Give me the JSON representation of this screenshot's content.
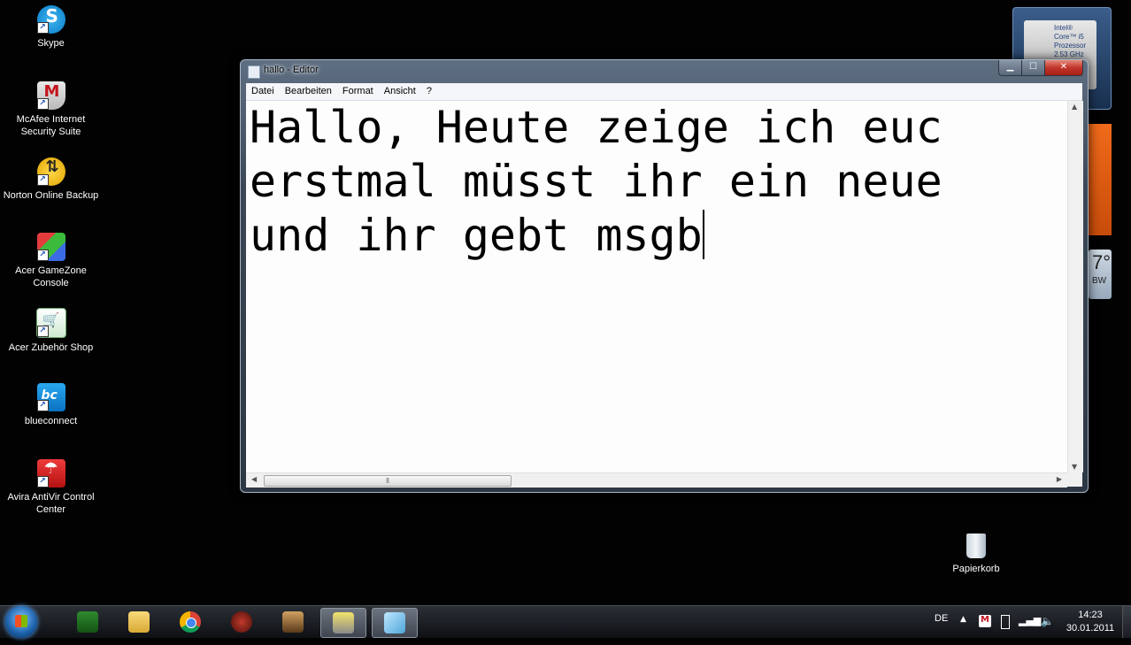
{
  "desktop": {
    "icons": [
      {
        "label": "Skype"
      },
      {
        "label": "McAfee Internet Security Suite"
      },
      {
        "label": "Norton Online Backup"
      },
      {
        "label": "Acer GameZone Console"
      },
      {
        "label": "Acer Zubehör Shop"
      },
      {
        "label": "blueconnect"
      },
      {
        "label": "Avira AntiVir Control Center"
      }
    ],
    "recycle_bin": {
      "label": "Papierkorb"
    }
  },
  "gadgets": {
    "cpu": {
      "line1": "Intel®",
      "line2": "Core™ i5",
      "line3": "Prozessor",
      "line4": "2.53 GHz"
    },
    "weather": {
      "temp": "7°",
      "location": "BW"
    }
  },
  "notepad": {
    "title": "hallo - Editor",
    "menu": [
      "Datei",
      "Bearbeiten",
      "Format",
      "Ansicht",
      "?"
    ],
    "content_lines": [
      "Hallo, Heute zeige ich euc",
      "erstmal müsst ihr ein neue",
      "und ihr gebt msgb"
    ]
  },
  "taskbar": {
    "language": "DE",
    "time": "14:23",
    "date": "30.01.2011"
  },
  "colors": {
    "desktop_bg": "#020202",
    "close_button": "#c2352b",
    "editor_bg": "#fdfdfd"
  }
}
